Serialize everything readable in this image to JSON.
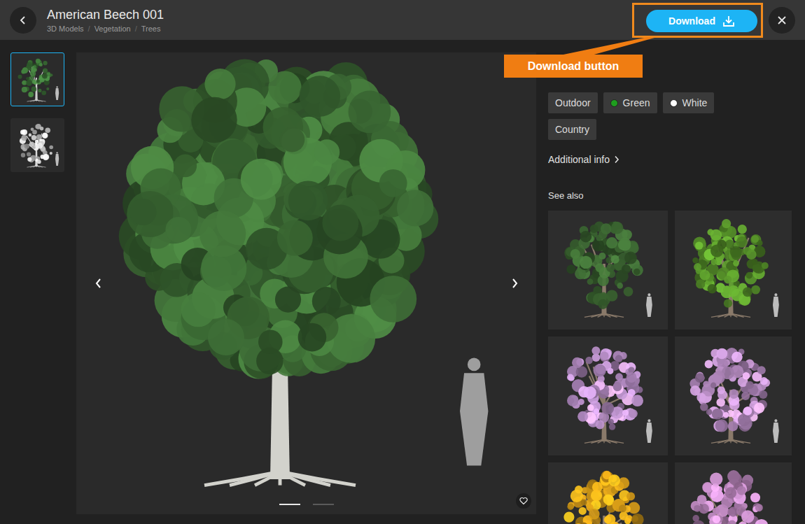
{
  "header": {
    "title": "American Beech 001",
    "breadcrumbs": [
      "3D Models",
      "Vegetation",
      "Trees"
    ],
    "separator": "/",
    "download": "Download"
  },
  "annotation": {
    "label": "Download button"
  },
  "thumbnails": [
    {
      "kind": "color",
      "selected": true
    },
    {
      "kind": "clay",
      "selected": false
    }
  ],
  "viewer": {
    "pages": [
      {
        "selected": true
      },
      {
        "selected": false
      }
    ]
  },
  "tags": [
    {
      "label": "Outdoor"
    },
    {
      "label": "Green",
      "color": "#1e9e1e"
    },
    {
      "label": "White",
      "color": "#ffffff"
    },
    {
      "label": "Country"
    }
  ],
  "additional_info": "Additional info",
  "see_also": {
    "title": "See also",
    "items": [
      {
        "color": "#3d6a33"
      },
      {
        "color": "#5c9c2c"
      },
      {
        "color": "#c79ad8"
      },
      {
        "color": "#c99ad6"
      },
      {
        "color": "#e2a418"
      },
      {
        "color": "#c88fca"
      }
    ]
  }
}
